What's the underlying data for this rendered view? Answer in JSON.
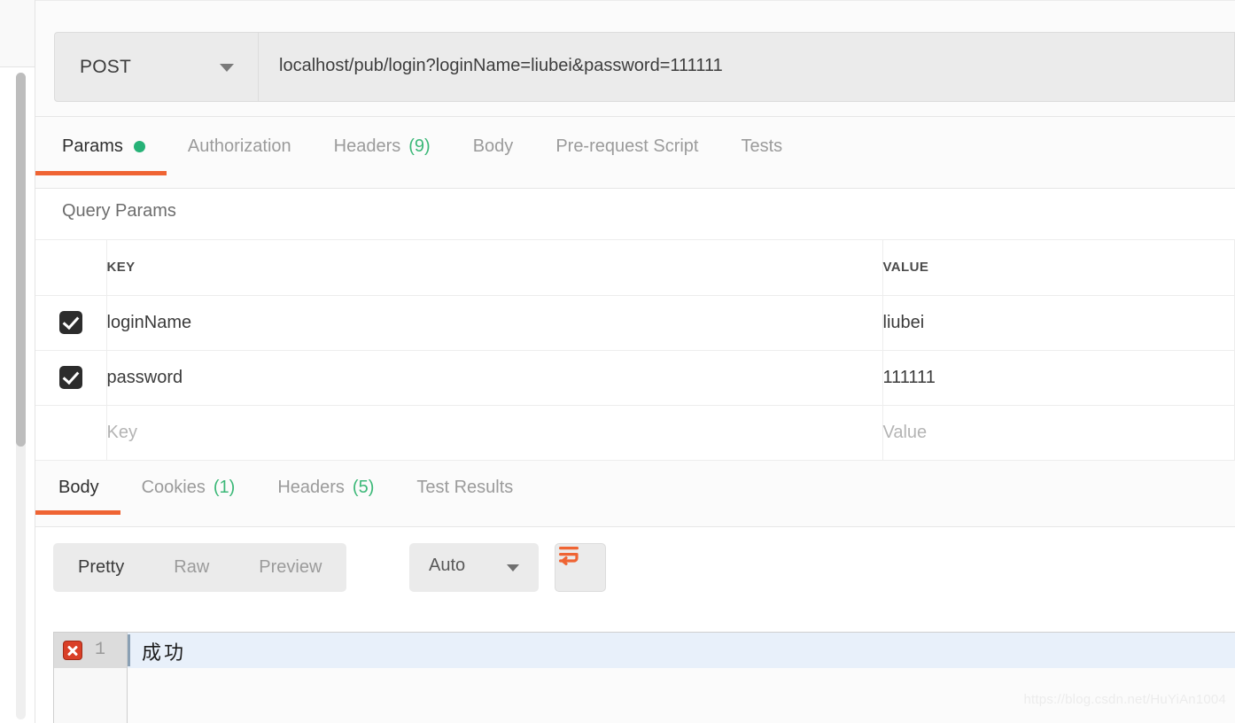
{
  "request": {
    "method": "POST",
    "url": "localhost/pub/login?loginName=liubei&password=111111",
    "tabs": [
      {
        "label": "Params",
        "count": "",
        "dot": true,
        "active": true
      },
      {
        "label": "Authorization",
        "count": "",
        "dot": false,
        "active": false
      },
      {
        "label": "Headers",
        "count": "(9)",
        "dot": false,
        "active": false
      },
      {
        "label": "Body",
        "count": "",
        "dot": false,
        "active": false
      },
      {
        "label": "Pre-request Script",
        "count": "",
        "dot": false,
        "active": false
      },
      {
        "label": "Tests",
        "count": "",
        "dot": false,
        "active": false
      }
    ]
  },
  "query_params": {
    "section_title": "Query Params",
    "headers": {
      "key": "KEY",
      "value": "VALUE"
    },
    "rows": [
      {
        "checked": true,
        "key": "loginName",
        "value": "liubei"
      },
      {
        "checked": true,
        "key": "password",
        "value": "111111"
      },
      {
        "checked": false,
        "key": "Key",
        "value": "Value",
        "placeholder": true
      }
    ]
  },
  "response": {
    "tabs": [
      {
        "label": "Body",
        "count": "",
        "active": true
      },
      {
        "label": "Cookies",
        "count": "(1)",
        "active": false
      },
      {
        "label": "Headers",
        "count": "(5)",
        "active": false
      },
      {
        "label": "Test Results",
        "count": "",
        "active": false
      }
    ],
    "view_modes": [
      {
        "label": "Pretty",
        "active": true
      },
      {
        "label": "Raw",
        "active": false
      },
      {
        "label": "Preview",
        "active": false
      }
    ],
    "format": "Auto",
    "body": {
      "line_number": "1",
      "content": "成功"
    }
  },
  "watermark": "https://blog.csdn.net/HuYiAn1004",
  "colors": {
    "accent_orange": "#ef6433",
    "status_green": "#3cb878",
    "dot_green": "#26b277",
    "error_red": "#d93f27",
    "active_line": "#e8f0fa"
  }
}
